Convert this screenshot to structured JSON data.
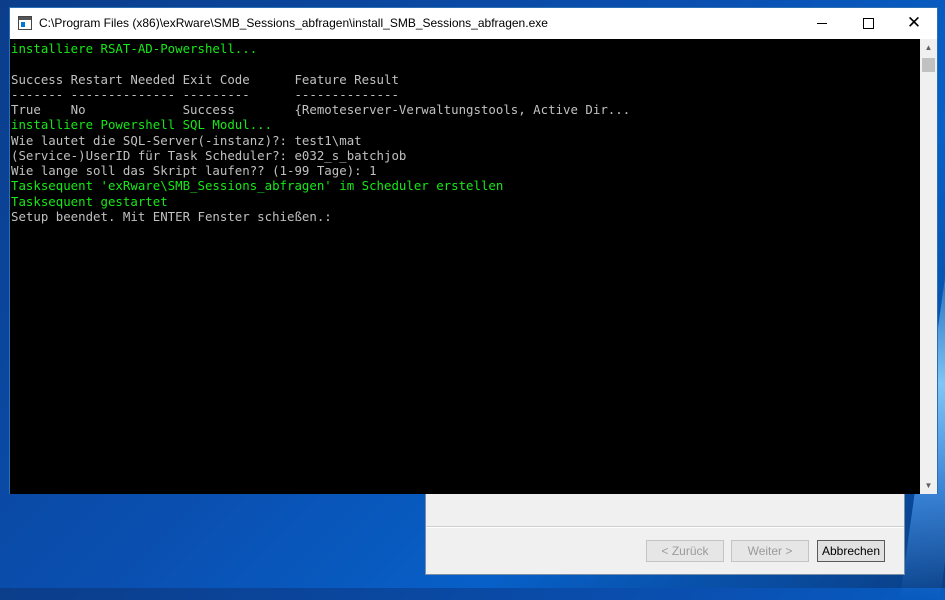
{
  "window": {
    "title": "C:\\Program Files (x86)\\exRware\\SMB_Sessions_abfragen\\install_SMB_Sessions_abfragen.exe",
    "minimize_icon": "minimize-icon",
    "maximize_icon": "maximize-icon",
    "close_icon": "close-icon",
    "close_glyph": "✕"
  },
  "console": {
    "background": "#000000",
    "green": "#17e817",
    "gray": "#c0c0c0",
    "lines": [
      {
        "text": "installiere RSAT-AD-Powershell...",
        "color": "green"
      },
      {
        "text": "",
        "color": "gray"
      },
      {
        "text": "Success Restart Needed Exit Code      Feature Result",
        "color": "gray"
      },
      {
        "text": "------- -------------- ---------      --------------",
        "color": "gray"
      },
      {
        "text": "True    No             Success        {Remoteserver-Verwaltungstools, Active Dir...",
        "color": "gray"
      },
      {
        "text": "installiere Powershell SQL Modul...",
        "color": "green"
      },
      {
        "text": "Wie lautet die SQL-Server(-instanz)?: test1\\mat",
        "color": "gray"
      },
      {
        "text": "(Service-)UserID für Task Scheduler?: e032_s_batchjob",
        "color": "gray"
      },
      {
        "text": "Wie lange soll das Skript laufen?? (1-99 Tage): 1",
        "color": "gray"
      },
      {
        "text": "Tasksequent 'exRware\\SMB_Sessions_abfragen' im Scheduler erstellen",
        "color": "green"
      },
      {
        "text": "Tasksequent gestartet",
        "color": "green"
      },
      {
        "text": "Setup beendet. Mit ENTER Fenster schießen.:",
        "color": "gray"
      }
    ]
  },
  "installer": {
    "back_label": "< Zurück",
    "next_label": "Weiter >",
    "cancel_label": "Abbrechen"
  }
}
